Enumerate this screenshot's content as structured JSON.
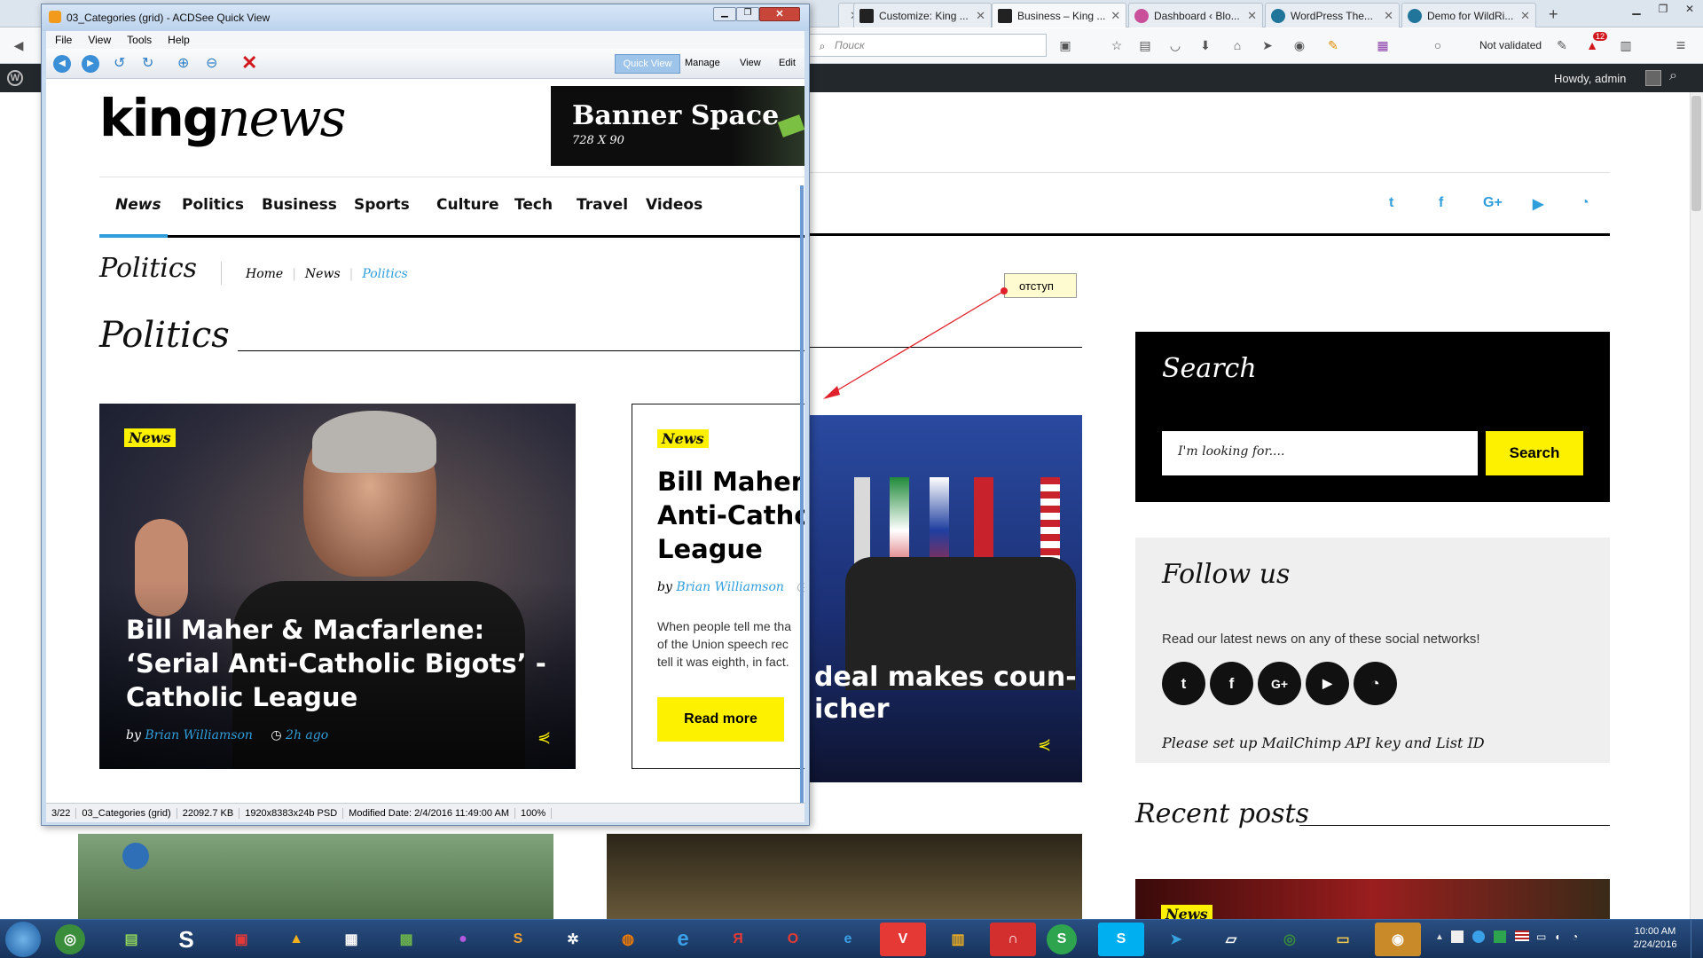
{
  "browser": {
    "tabs": [
      {
        "label": "Customize: King ...",
        "active": false
      },
      {
        "label": "Business – King ...",
        "active": true
      },
      {
        "label": "Dashboard ‹ Blo...",
        "active": false
      },
      {
        "label": "WordPress The...",
        "active": false
      },
      {
        "label": "Demo for WildRi...",
        "active": false
      }
    ],
    "new_tab": "+",
    "search_placeholder": "Поиск",
    "validation_text": "Not validated",
    "badge_count": "12"
  },
  "adminbar": {
    "greeting": "Howdy, admin"
  },
  "quickview": {
    "title": "03_Categories (grid) - ACDSee Quick View",
    "menu": [
      "File",
      "View",
      "Tools",
      "Help"
    ],
    "mode_buttons": [
      "Quick View",
      "Manage",
      "View",
      "Edit"
    ],
    "status": [
      "3/22",
      "03_Categories (grid)",
      "22092.7 KB",
      "1920x8383x24b PSD",
      "Modified Date: 2/4/2016 11:49:00 AM",
      "100%"
    ]
  },
  "site": {
    "logo_bold": "king",
    "logo_light": "news",
    "banner_title": "Banner Space",
    "banner_size": "728 X 90",
    "nav": [
      "News",
      "Politics",
      "Business",
      "Sports",
      "Culture",
      "Tech",
      "Travel",
      "Videos"
    ],
    "social_top": [
      "twitter-icon",
      "facebook-icon",
      "google-plus-icon",
      "youtube-icon",
      "rss-icon"
    ],
    "breadcrumb_title": "Politics",
    "breadcrumb": [
      "Home",
      "News",
      "Politics"
    ],
    "section_title": "Politics",
    "post1": {
      "badge": "News",
      "title": "Bill Maher & Macfarlene: ‘Serial Anti-Catholic Bigots’ - Catholic League",
      "by": "by",
      "author": "Brian Williamson",
      "time": "2h ago"
    },
    "post2": {
      "badge": "News",
      "title_lines": [
        "Bill Maher &",
        "Anti-Cathol",
        "League"
      ],
      "by": "by",
      "author": "Brian Williamson",
      "excerpt_lines": [
        "When people tell me tha",
        "of the Union speech rec",
        "tell it was eighth, in fact."
      ],
      "read_more": "Read more"
    },
    "post3": {
      "title_lines": [
        "deal makes coun-",
        "icher"
      ]
    },
    "annotation": "отступ",
    "search_widget": {
      "title": "Search",
      "placeholder": "I'm looking for....",
      "button": "Search"
    },
    "follow_widget": {
      "title": "Follow us",
      "text": "Read our latest news on any of these social networks!",
      "icons": [
        "twitter-icon",
        "facebook-icon",
        "google-plus-icon",
        "youtube-icon",
        "rss-icon"
      ],
      "mailchimp": "Please set up MailChimp API key and List ID"
    },
    "recent_title": "Recent posts",
    "recent_badge": "News"
  },
  "taskbar": {
    "time": "10:00 AM",
    "date": "2/24/2016"
  },
  "colors": {
    "accent": "#fdf100",
    "link": "#2f9edb",
    "dark": "#000000"
  }
}
